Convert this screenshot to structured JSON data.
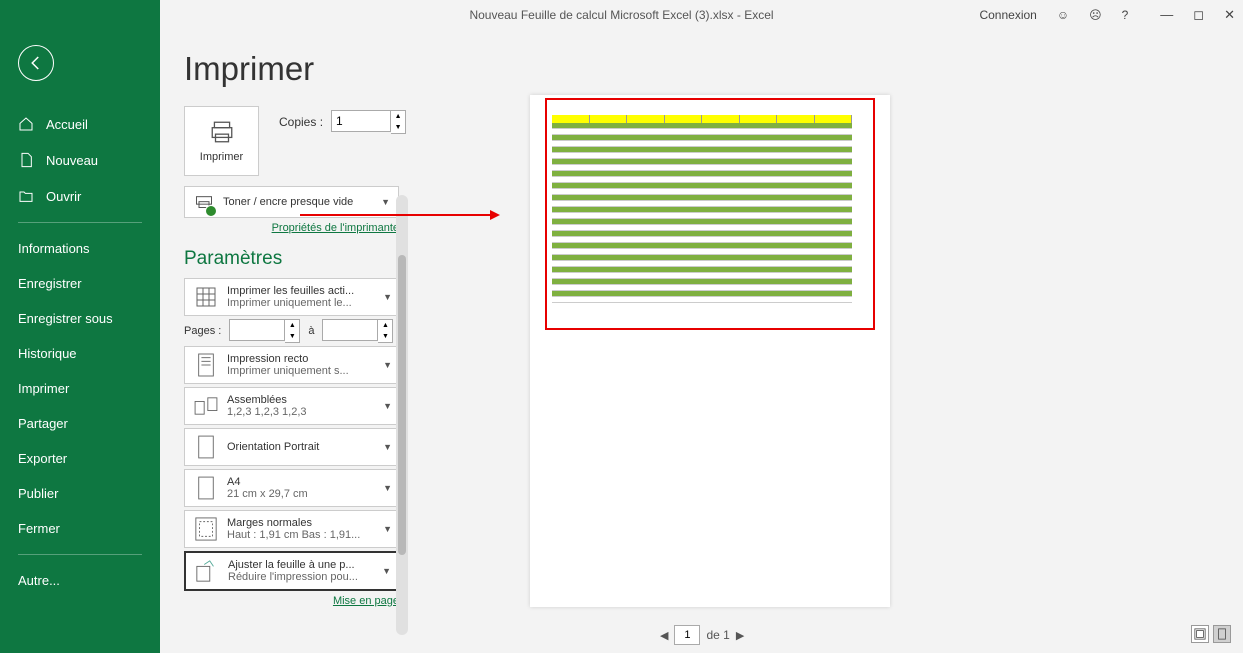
{
  "titlebar": {
    "title": "Nouveau Feuille de calcul Microsoft Excel (3).xlsx  -  Excel",
    "login": "Connexion"
  },
  "sidebar": {
    "home": "Accueil",
    "new": "Nouveau",
    "open": "Ouvrir",
    "info": "Informations",
    "save": "Enregistrer",
    "saveas": "Enregistrer sous",
    "history": "Historique",
    "print": "Imprimer",
    "share": "Partager",
    "export": "Exporter",
    "publish": "Publier",
    "close": "Fermer",
    "more": "Autre..."
  },
  "page": {
    "title": "Imprimer",
    "copies_label": "Copies :",
    "copies_value": "1",
    "print_btn": "Imprimer",
    "printer_status": "Toner / encre presque vide",
    "printer_props": "Propriétés de l'imprimante",
    "params_title": "Paramètres",
    "settings": {
      "sheets": {
        "line1": "Imprimer les feuilles acti...",
        "line2": "Imprimer uniquement le..."
      },
      "pages_label": "Pages :",
      "pages_to": "à",
      "recto": {
        "line1": "Impression recto",
        "line2": "Imprimer uniquement s..."
      },
      "collate": {
        "line1": "Assemblées",
        "line2": "1,2,3    1,2,3    1,2,3"
      },
      "orientation": {
        "line1": "Orientation Portrait"
      },
      "paper": {
        "line1": "A4",
        "line2": "21 cm x 29,7 cm"
      },
      "margins": {
        "line1": "Marges normales",
        "line2": "Haut : 1,91 cm Bas : 1,91..."
      },
      "scale": {
        "line1": "Ajuster la feuille à une p...",
        "line2": "Réduire l'impression pou..."
      }
    },
    "page_setup": "Mise en page",
    "page_nav": {
      "of": "de 1",
      "current": "1"
    }
  }
}
